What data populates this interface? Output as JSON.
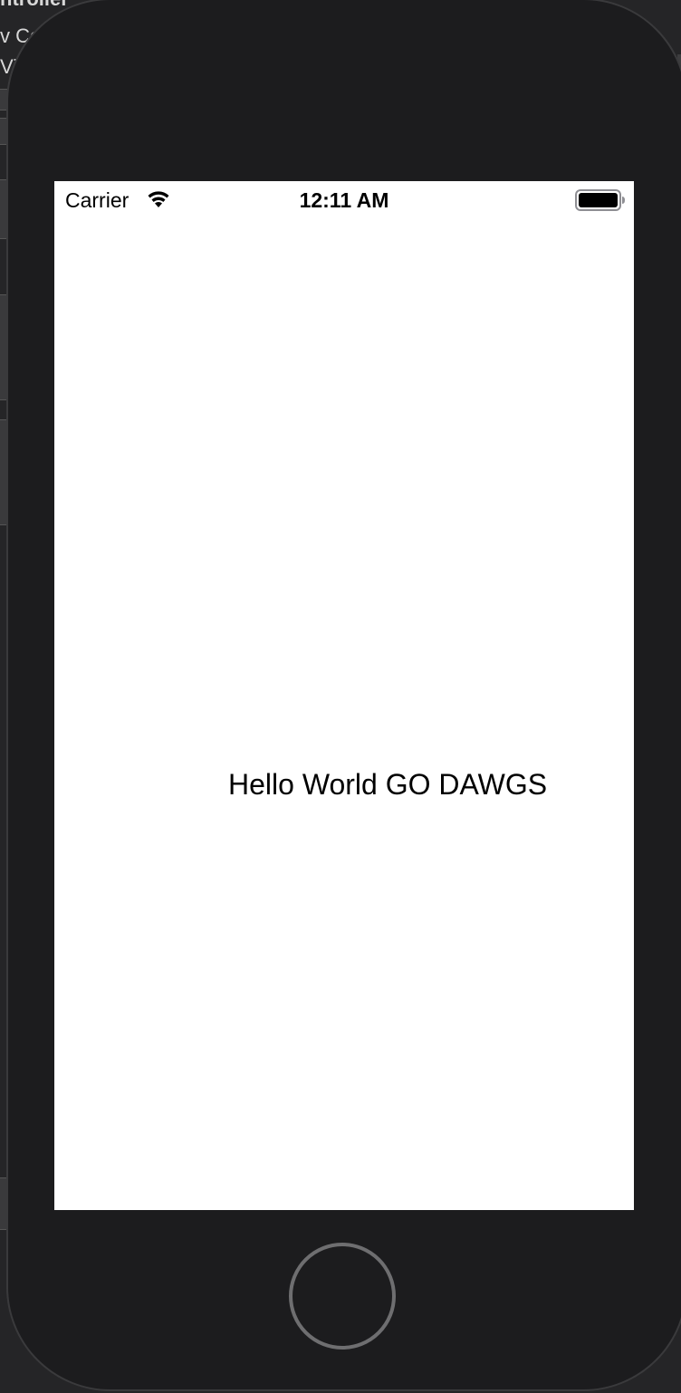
{
  "background_window": {
    "title_fragment": "ntroller",
    "line1_fragment": "v Co",
    "line2_fragment": "Vie"
  },
  "status_bar": {
    "carrier": "Carrier",
    "time": "12:11 AM",
    "wifi_icon": "wifi-icon",
    "battery_icon": "battery-icon"
  },
  "screen": {
    "label_text": "Hello World GO DAWGS"
  },
  "device": {
    "home_button_icon": "home-button-circle",
    "frame_color": "#1c1c1e"
  }
}
